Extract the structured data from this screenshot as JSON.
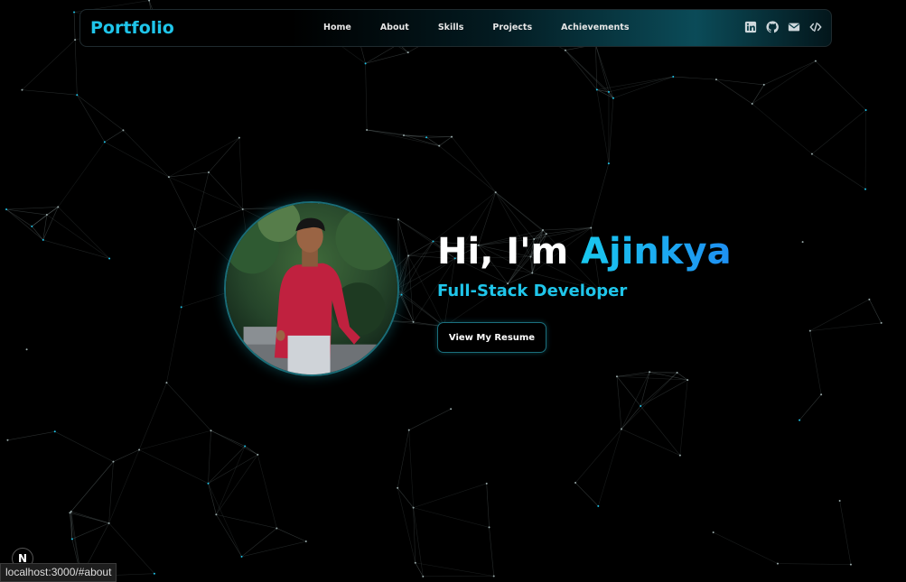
{
  "nav": {
    "brand": "Portfolio",
    "links": [
      {
        "label": "Home"
      },
      {
        "label": "About"
      },
      {
        "label": "Skills"
      },
      {
        "label": "Projects"
      },
      {
        "label": "Achievements"
      }
    ],
    "icons": [
      "linkedin-icon",
      "github-icon",
      "mail-icon",
      "code-icon"
    ]
  },
  "hero": {
    "greeting": "Hi, I'm ",
    "name": "Ajinkya",
    "subtitle": "Full-Stack Developer",
    "resume_label": "View My Resume"
  },
  "dev_badge": "N",
  "status_url": "localhost:3000/#about",
  "colors": {
    "accent": "#1fc5ea",
    "accent_gradient_end": "#1e8ff2",
    "background": "#000000"
  }
}
